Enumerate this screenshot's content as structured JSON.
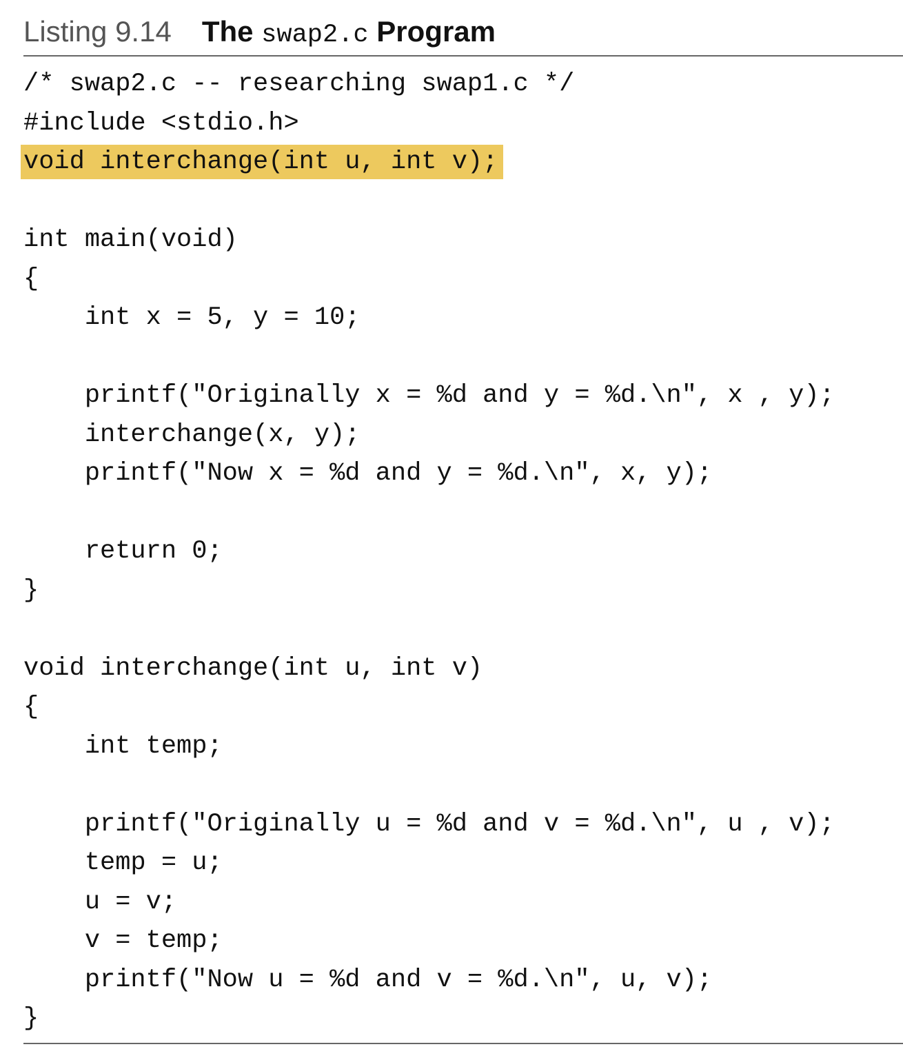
{
  "listing": {
    "number": "Listing 9.14",
    "title_before": "The ",
    "title_code": "swap2.c",
    "title_after": " Program"
  },
  "highlight_color": "#edc95e",
  "code_lines": [
    "/* swap2.c -- researching swap1.c */",
    "#include <stdio.h>",
    "void interchange(int u, int v);",
    "",
    "int main(void)",
    "{",
    "    int x = 5, y = 10;",
    "",
    "    printf(\"Originally x = %d and y = %d.\\n\", x , y);",
    "    interchange(x, y);",
    "    printf(\"Now x = %d and y = %d.\\n\", x, y);",
    "",
    "    return 0;",
    "}",
    "",
    "void interchange(int u, int v)",
    "{",
    "    int temp;",
    "",
    "    printf(\"Originally u = %d and v = %d.\\n\", u , v);",
    "    temp = u;",
    "    u = v;",
    "    v = temp;",
    "    printf(\"Now u = %d and v = %d.\\n\", u, v);",
    "}"
  ]
}
